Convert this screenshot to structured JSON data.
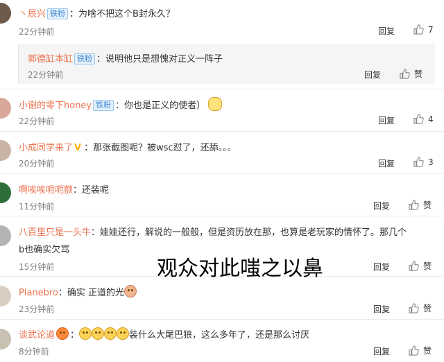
{
  "reply_label": "回复",
  "like_label": "赞",
  "badge_label": "铁粉",
  "overlay_caption": "观众对此嗤之以鼻",
  "comments": [
    {
      "user": "丶辰兴",
      "text": "：为啥不把这个B封永久？",
      "time": "22分钟前",
      "likes": "7",
      "avatar_color": "#6e5a4a"
    },
    {
      "user": "郭德缸本缸",
      "text": "：说明他只是想愧对正义一阵子",
      "time": "22分钟前",
      "likes": "赞",
      "avatar_color": ""
    },
    {
      "user": "小谢的零下honey",
      "text": "：你也是正义的使者）",
      "time": "22分钟前",
      "likes": "4",
      "avatar_color": "#d9a79a"
    },
    {
      "user": "小成同学来了",
      "text": "：那张截图呢？被wsc怼了，还舔。。。",
      "time": "20分钟前",
      "likes": "3",
      "avatar_color": "#c9b3a6"
    },
    {
      "user": "啊唉唉呃呃额",
      "text": "：还装呢",
      "time": "11分钟前",
      "likes": "赞",
      "avatar_color": "#2f6e3b"
    },
    {
      "user": "八百里只是一头牛",
      "text": "：娃娃还行，解说的一般般，但是资历放在那，也算是老玩家的情怀了。那几个",
      "text2": "b也确实欠骂",
      "time": "15分钟前",
      "likes": "赞",
      "avatar_color": "#b4b4b4"
    },
    {
      "user": "Planebro",
      "text": "：确实 正道的光",
      "time": "23分钟前",
      "likes": "赞",
      "avatar_color": "#d8cfc0"
    },
    {
      "user": "谈武论道",
      "text": "装什么大尾巴狼，这么多年了，还是那么讨厌",
      "time": "8分钟前",
      "likes": "赞",
      "avatar_color": "#c8c0b0"
    }
  ]
}
